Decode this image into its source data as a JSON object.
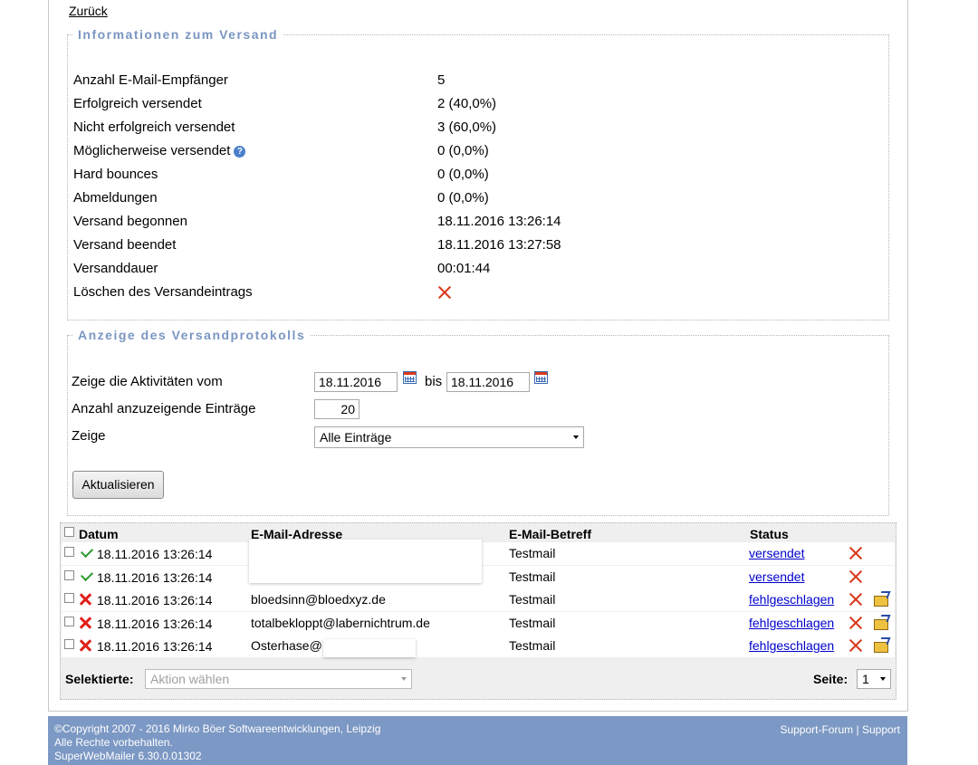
{
  "nav": {
    "back": "Zurück"
  },
  "info": {
    "legend": "Informationen zum Versand",
    "rows": [
      {
        "label": "Anzahl E-Mail-Empfänger",
        "value": "5"
      },
      {
        "label": "Erfolgreich versendet",
        "value": "2 (40,0%)"
      },
      {
        "label": "Nicht erfolgreich versendet",
        "value": "3 (60,0%)"
      },
      {
        "label": "Möglicherweise versendet",
        "value": "0 (0,0%)"
      },
      {
        "label": "Hard bounces",
        "value": "0 (0,0%)"
      },
      {
        "label": "Abmeldungen",
        "value": "0 (0,0%)"
      },
      {
        "label": "Versand begonnen",
        "value": "18.11.2016 13:26:14"
      },
      {
        "label": "Versand beendet",
        "value": "18.11.2016 13:27:58"
      },
      {
        "label": "Versanddauer",
        "value": "00:01:44"
      },
      {
        "label": "Löschen des Versandeintrags",
        "value": ""
      }
    ],
    "help_icon_text": "?"
  },
  "log": {
    "legend": "Anzeige des Versandprotokolls",
    "date_label": "Zeige die Aktivitäten vom",
    "date_from": "18.11.2016",
    "bis": "bis",
    "date_to": "18.11.2016",
    "count_label": "Anzahl anzuzeigende Einträge",
    "count_value": "20",
    "show_label": "Zeige",
    "show_value": "Alle Einträge",
    "refresh_button": "Aktualisieren"
  },
  "table": {
    "headers": {
      "date": "Datum",
      "email": "E-Mail-Adresse",
      "subject": "E-Mail-Betreff",
      "status": "Status"
    },
    "rows": [
      {
        "success": true,
        "date": "18.11.2016 13:26:14",
        "email": "",
        "subject": "Testmail",
        "status": "versendet"
      },
      {
        "success": true,
        "date": "18.11.2016 13:26:14",
        "email": "",
        "subject": "Testmail",
        "status": "versendet"
      },
      {
        "success": false,
        "date": "18.11.2016 13:26:14",
        "email": "bloedsinn@bloedxyz.de",
        "subject": "Testmail",
        "status": "fehlgeschlagen"
      },
      {
        "success": false,
        "date": "18.11.2016 13:26:14",
        "email": "totalbekloppt@labernichtrum.de",
        "subject": "Testmail",
        "status": "fehlgeschlagen"
      },
      {
        "success": false,
        "date": "18.11.2016 13:26:14",
        "email": "Osterhase@",
        "subject": "Testmail",
        "status": "fehlgeschlagen"
      }
    ],
    "selected_label": "Selektierte:",
    "action_placeholder": "Aktion wählen",
    "page_label": "Seite:",
    "page_value": "1"
  },
  "footer": {
    "copyright": "©Copyright 2007 - 2016 Mirko Böer Softwareentwicklungen, Leipzig",
    "rights": "Alle Rechte vorbehalten.",
    "version": "SuperWebMailer 6.30.0.01302",
    "support_forum": "Support-Forum",
    "separator": "|",
    "support": "Support"
  }
}
